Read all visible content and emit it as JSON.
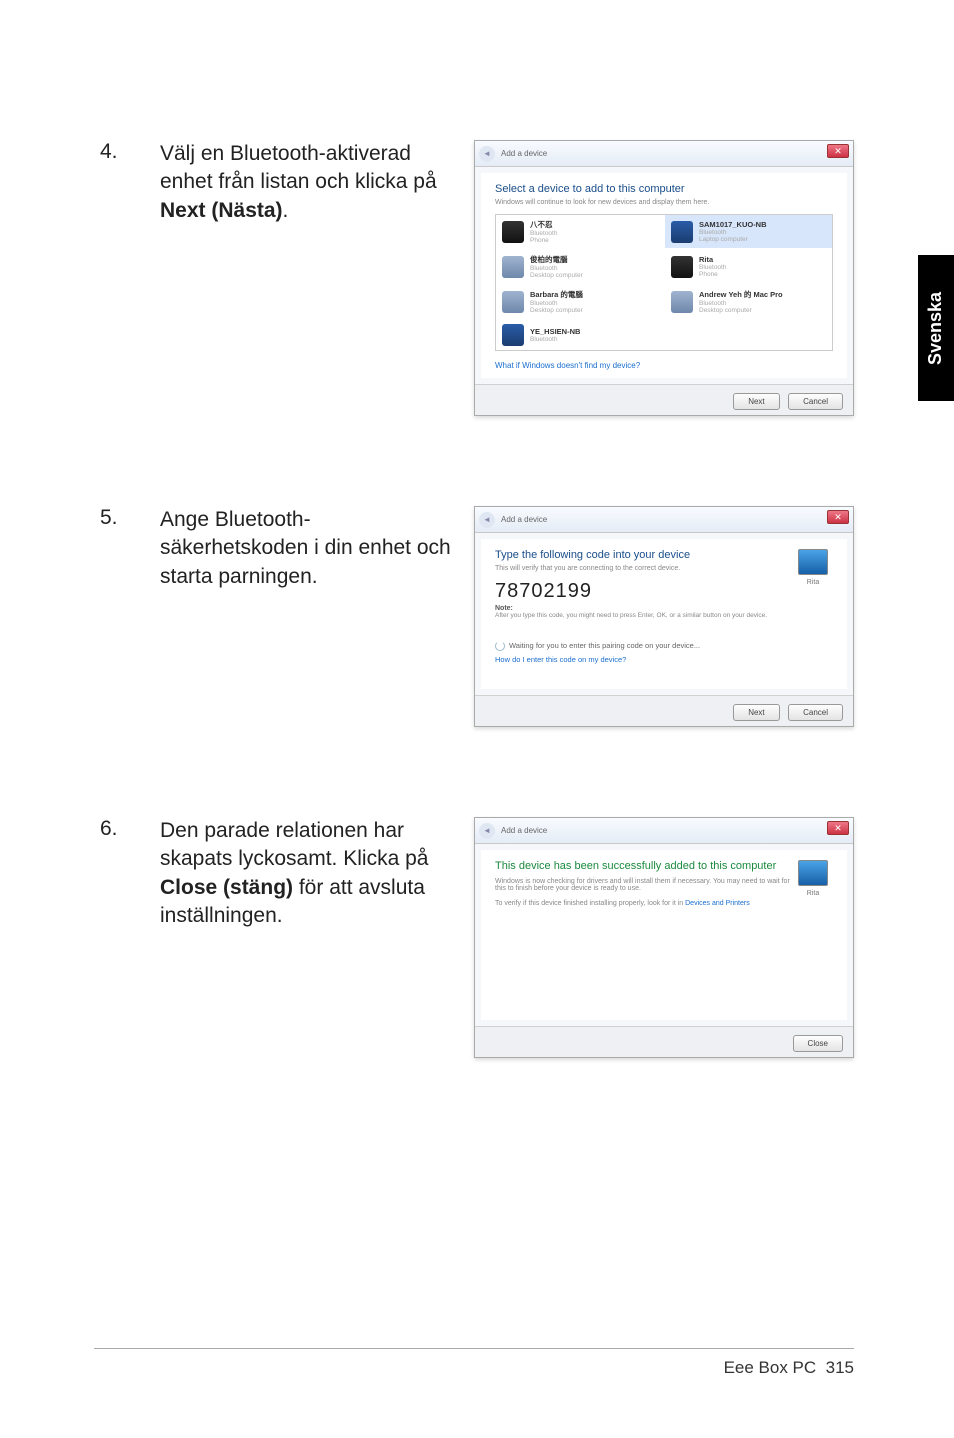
{
  "side_tab": "Svenska",
  "footer": {
    "product": "Eee Box PC",
    "page_num": "315"
  },
  "steps": [
    {
      "num": "4.",
      "text_plain": "Välj en Bluetooth-aktiverad enhet från listan och klicka på ",
      "text_bold": "Next (Nästa)",
      "text_after": "."
    },
    {
      "num": "5.",
      "text_plain": "Ange Bluetooth-säkerhetskoden i din enhet och starta parningen.",
      "text_bold": "",
      "text_after": ""
    },
    {
      "num": "6.",
      "text_plain": "Den parade relationen har skapats lyckosamt. Klicka på ",
      "text_bold": "Close (stäng)",
      "text_after": " för att avsluta inställningen."
    }
  ],
  "dialog1": {
    "title": "Add a device",
    "heading": "Select a device to add to this computer",
    "sub": "Windows will continue to look for new devices and display them here.",
    "link": "What if Windows doesn't find my device?",
    "btn_next": "Next",
    "btn_cancel": "Cancel",
    "devices": [
      {
        "name": "八不忍",
        "line2": "Bluetooth",
        "line3": "Phone",
        "icon": "ph"
      },
      {
        "name": "SAM1017_KUO-NB",
        "line2": "Bluetooth",
        "line3": "Laptop computer",
        "icon": "lap",
        "selected": true
      },
      {
        "name": "俊柏的電腦",
        "line2": "Bluetooth",
        "line3": "Desktop computer",
        "icon": "pc"
      },
      {
        "name": "Rita",
        "line2": "Bluetooth",
        "line3": "Phone",
        "icon": "ph"
      },
      {
        "name": "Barbara 的電腦",
        "line2": "Bluetooth",
        "line3": "Desktop computer",
        "icon": "pc"
      },
      {
        "name": "Andrew Yeh 的 Mac Pro",
        "line2": "Bluetooth",
        "line3": "Desktop computer",
        "icon": "pc"
      },
      {
        "name": "YE_HSIEN-NB",
        "line2": "Bluetooth",
        "line3": "",
        "icon": "lap"
      },
      null
    ]
  },
  "dialog2": {
    "title": "Add a device",
    "heading": "Type the following code into your device",
    "sub": "This will verify that you are connecting to the correct device.",
    "code": "78702199",
    "note_label": "Note:",
    "note": "After you type this code, you might need to press Enter, OK, or a similar button on your device.",
    "waiting": "Waiting for you to enter this pairing code on your device...",
    "help": "How do I enter this code on my device?",
    "right_caption": "Rita",
    "btn_next": "Next",
    "btn_cancel": "Cancel"
  },
  "dialog3": {
    "title": "Add a device",
    "heading": "This device has been successfully added to this computer",
    "para1": "Windows is now checking for drivers and will install them if necessary. You may need to wait for this to finish before your device is ready to use.",
    "para2a": "To verify if this device finished installing properly, look for it in ",
    "para2b": "Devices and Printers",
    "right_caption": "Rita",
    "btn_close": "Close"
  }
}
